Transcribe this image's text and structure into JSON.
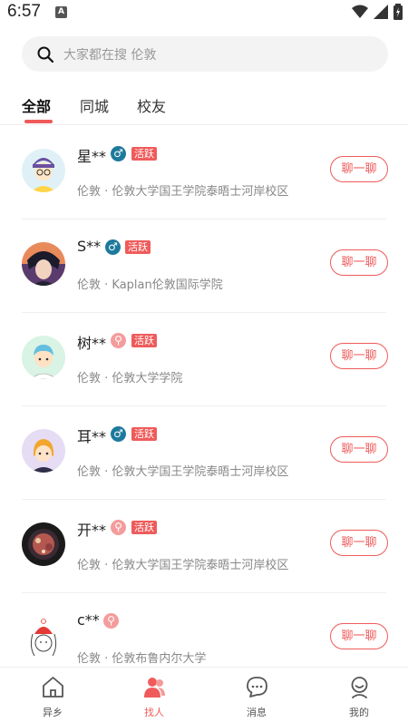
{
  "status_bar": {
    "time": "6:57",
    "notification_letter": "A"
  },
  "search": {
    "placeholder": "大家都在搜 伦敦"
  },
  "tabs": [
    {
      "label": "全部",
      "active": true
    },
    {
      "label": "同城",
      "active": false
    },
    {
      "label": "校友",
      "active": false
    }
  ],
  "people": [
    {
      "name": "星**",
      "gender": "male",
      "gender_symbol": "♂",
      "badge": "活跃",
      "location": "伦敦 · 伦敦大学国王学院泰晤士河岸校区",
      "action": "聊一聊"
    },
    {
      "name": "S**",
      "gender": "male",
      "gender_symbol": "♂",
      "badge": "活跃",
      "location": "伦敦 · Kaplan伦敦国际学院",
      "action": "聊一聊"
    },
    {
      "name": "树**",
      "gender": "other",
      "gender_symbol": "⚲",
      "badge": "活跃",
      "location": "伦敦 · 伦敦大学学院",
      "action": "聊一聊"
    },
    {
      "name": "耳**",
      "gender": "male",
      "gender_symbol": "♂",
      "badge": "活跃",
      "location": "伦敦 · 伦敦大学国王学院泰晤士河岸校区",
      "action": "聊一聊"
    },
    {
      "name": "开**",
      "gender": "other",
      "gender_symbol": "⚲",
      "badge": "活跃",
      "location": "伦敦 · 伦敦大学国王学院泰晤士河岸校区",
      "action": "聊一聊"
    },
    {
      "name": "c**",
      "gender": "other",
      "gender_symbol": "⚲",
      "badge": "",
      "location": "伦敦 · 伦敦布鲁内尔大学",
      "action": "聊一聊"
    }
  ],
  "bottom_nav": [
    {
      "label": "异乡",
      "icon": "home-icon",
      "active": false
    },
    {
      "label": "找人",
      "icon": "people-icon",
      "active": true
    },
    {
      "label": "消息",
      "icon": "chat-bubble-icon",
      "active": false
    },
    {
      "label": "我的",
      "icon": "profile-icon",
      "active": false
    }
  ],
  "colors": {
    "accent": "#ef5b5b",
    "male": "#1e7a9c",
    "other": "#f49c9c"
  }
}
